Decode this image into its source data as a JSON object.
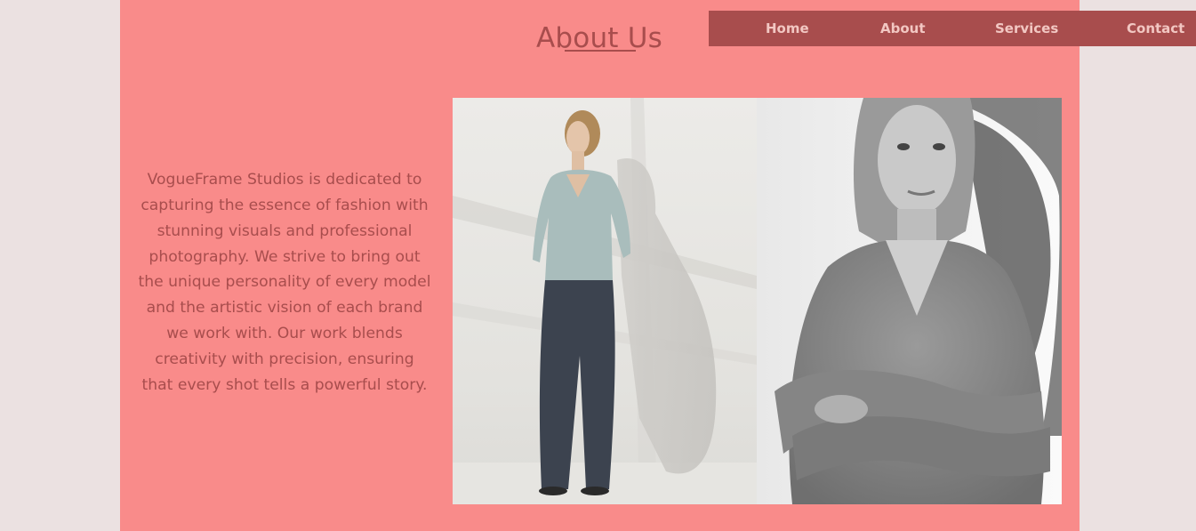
{
  "header": {
    "title": "About Us"
  },
  "nav": {
    "items": [
      {
        "label": "Home"
      },
      {
        "label": "About"
      },
      {
        "label": "Services"
      },
      {
        "label": "Contact"
      }
    ]
  },
  "about": {
    "text": "VogueFrame Studios is dedicated to capturing the essence of fashion with stunning visuals and professional photography. We strive to bring out the unique personality of every model and the artistic vision of each brand we work with. Our work blends creativity with precision, ensuring that every shot tells a powerful story."
  },
  "gallery": {
    "images": [
      {
        "name": "model-standing-photo"
      },
      {
        "name": "model-arms-crossed-photo"
      }
    ]
  },
  "colors": {
    "background": "#ebe1e1",
    "panel": "#f98b8a",
    "accent": "#a84d4d",
    "nav_text": "#f2c7c2"
  }
}
